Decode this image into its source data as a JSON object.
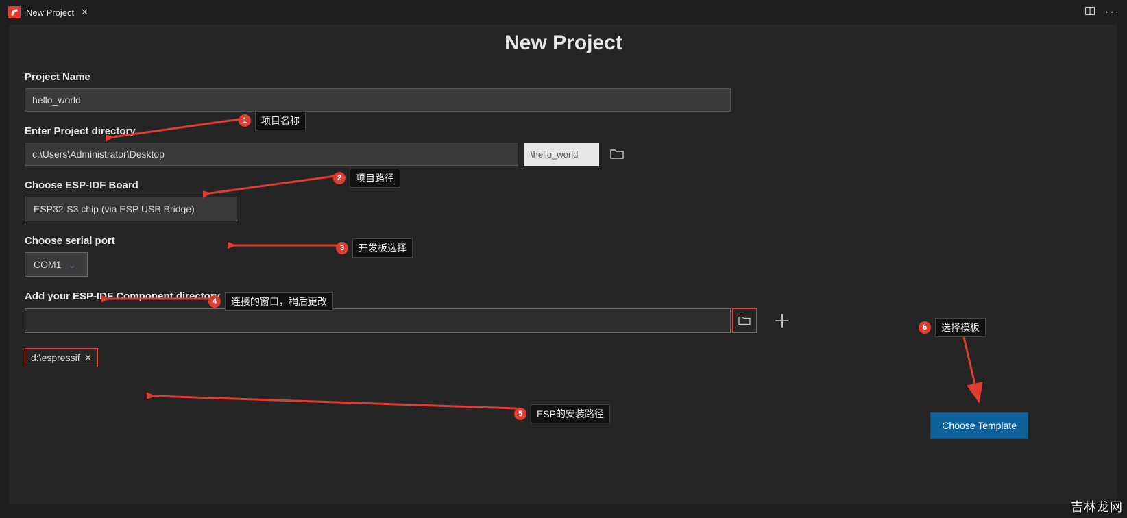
{
  "titlebar": {
    "tab_name": "New Project"
  },
  "page": {
    "title": "New Project"
  },
  "form": {
    "project_name_label": "Project Name",
    "project_name_value": "hello_world",
    "project_dir_label": "Enter Project directory",
    "project_dir_value": "c:\\Users\\Administrator\\Desktop",
    "project_dir_suffix": "\\hello_world",
    "board_label": "Choose ESP-IDF Board",
    "board_value": "ESP32-S3 chip (via ESP USB Bridge)",
    "serial_label": "Choose serial port",
    "serial_value": "COM1",
    "component_label": "Add your ESP-IDF Component directory",
    "chip_path": "d:\\espressif",
    "choose_template": "Choose Template"
  },
  "annotations": {
    "a1": {
      "num": "1",
      "text": "项目名称"
    },
    "a2": {
      "num": "2",
      "text": "项目路径"
    },
    "a3": {
      "num": "3",
      "text": "开发板选择"
    },
    "a4": {
      "num": "4",
      "text": "连接的窗口，稍后更改"
    },
    "a5": {
      "num": "5",
      "text": "ESP的安装路径"
    },
    "a6": {
      "num": "6",
      "text": "选择模板"
    }
  },
  "watermark": "吉林龙网"
}
